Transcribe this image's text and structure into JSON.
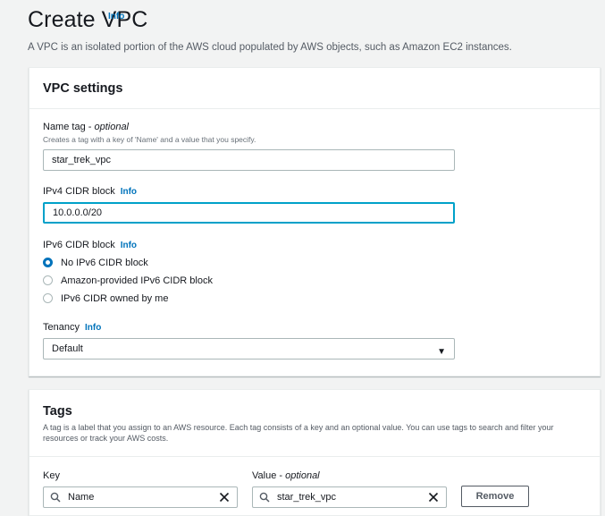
{
  "header": {
    "title": "Create VPC",
    "info": "Info",
    "description": "A VPC is an isolated portion of the AWS cloud populated by AWS objects, such as Amazon EC2 instances."
  },
  "vpc_settings": {
    "title": "VPC settings",
    "name_tag": {
      "label": "Name tag - ",
      "optional": "optional",
      "description": "Creates a tag with a key of 'Name' and a value that you specify.",
      "value": "star_trek_vpc"
    },
    "ipv4": {
      "label": "IPv4 CIDR block",
      "info": "Info",
      "value": "10.0.0.0/20"
    },
    "ipv6": {
      "label": "IPv6 CIDR block",
      "info": "Info",
      "options": [
        {
          "label": "No IPv6 CIDR block",
          "selected": true
        },
        {
          "label": "Amazon-provided IPv6 CIDR block",
          "selected": false
        },
        {
          "label": "IPv6 CIDR owned by me",
          "selected": false
        }
      ]
    },
    "tenancy": {
      "label": "Tenancy",
      "info": "Info",
      "value": "Default"
    }
  },
  "tags": {
    "title": "Tags",
    "description": "A tag is a label that you assign to an AWS resource. Each tag consists of a key and an optional value. You can use tags to search and filter your resources or track your AWS costs.",
    "key_label": "Key",
    "value_label": "Value - ",
    "value_optional": "optional",
    "rows": [
      {
        "key": "Name",
        "value": "star_trek_vpc",
        "remove_label": "Remove"
      }
    ]
  },
  "colors": {
    "accent": "#0073bb",
    "focus": "#00a1c9"
  }
}
